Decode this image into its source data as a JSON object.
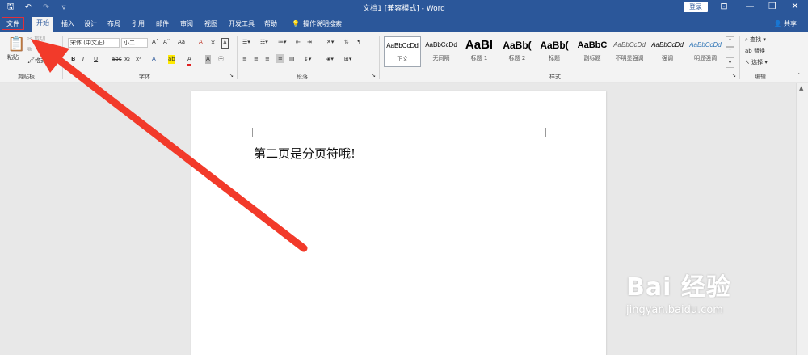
{
  "titlebar": {
    "doc_title": "文档1 [兼容模式] - Word",
    "login_label": "登录",
    "save_glyph": "🖫",
    "undo_glyph": "↶",
    "redo_glyph": "↷",
    "customize_glyph": "▿",
    "ribbon_opts_glyph": "⊡",
    "min_glyph": "—",
    "max_glyph": "❐",
    "close_glyph": "✕"
  },
  "tabs": {
    "file": "文件",
    "home": "开始",
    "insert": "插入",
    "design": "设计",
    "layout": "布局",
    "references": "引用",
    "mailings": "邮件",
    "review": "审阅",
    "view": "视图",
    "developer": "开发工具",
    "help": "帮助",
    "tell_me": "操作说明搜索",
    "share": "共享"
  },
  "clipboard": {
    "paste": "粘贴",
    "cut": "剪切",
    "label": "剪贴板",
    "format_painter": "格式刷"
  },
  "font": {
    "family": "宋体 (中文正)",
    "size": "小二",
    "label": "字体",
    "bold": "B",
    "italic": "I",
    "underline": "U",
    "strike": "abc",
    "sub": "x₂",
    "sup": "x²",
    "grow": "A˄",
    "shrink": "A˅",
    "case": "Aa",
    "clear": "A",
    "highlight": "ab",
    "color": "A",
    "charshade": "A",
    "border": "A"
  },
  "paragraph": {
    "label": "段落"
  },
  "styles": {
    "label": "样式",
    "items": [
      {
        "preview": "AaBbCcDd",
        "name": "正文"
      },
      {
        "preview": "AaBbCcDd",
        "name": "无间隔"
      },
      {
        "preview": "AaBl",
        "name": "标题 1"
      },
      {
        "preview": "AaBb(",
        "name": "标题 2"
      },
      {
        "preview": "AaBb(",
        "name": "标题"
      },
      {
        "preview": "AaBbC",
        "name": "副标题"
      },
      {
        "preview": "AaBbCcDd",
        "name": "不明显强调"
      },
      {
        "preview": "AaBbCcDd",
        "name": "强调"
      },
      {
        "preview": "AaBbCcDd",
        "name": "明显强调"
      }
    ]
  },
  "editing": {
    "label": "编辑",
    "find": "查找",
    "replace": "替换",
    "select": "选择"
  },
  "document": {
    "text": "第二页是分页符哦!"
  },
  "watermark": {
    "brand": "Bai  经验",
    "url": "jingyan.baidu.com"
  }
}
